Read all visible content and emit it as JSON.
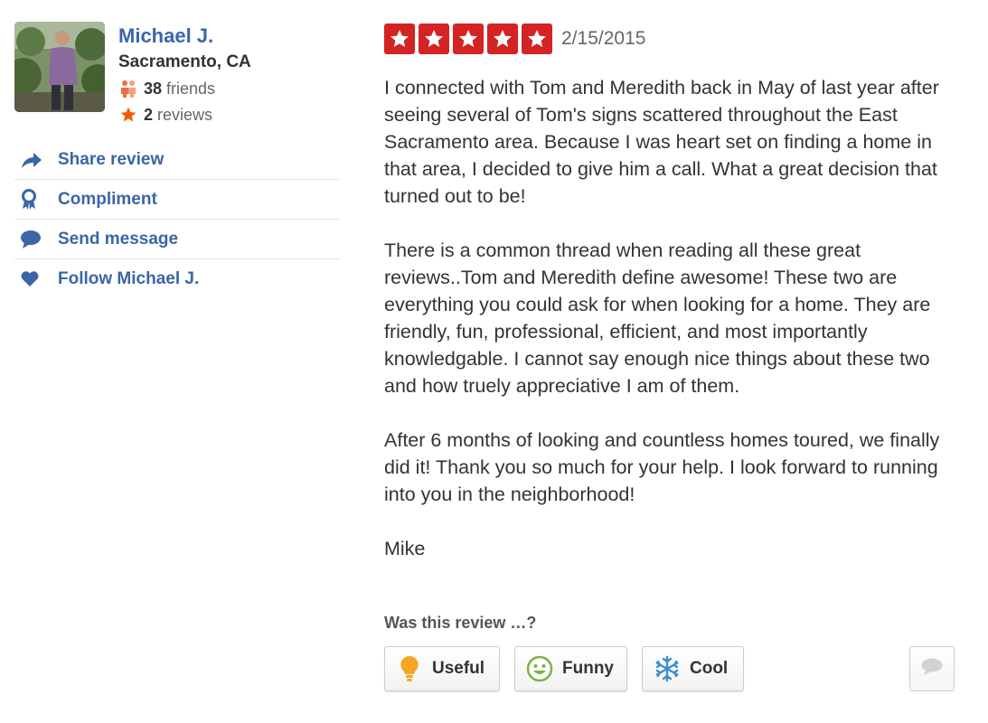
{
  "user": {
    "name": "Michael J.",
    "location": "Sacramento, CA",
    "friends_count": "38",
    "friends_label": "friends",
    "reviews_count": "2",
    "reviews_label": "reviews",
    "avatar_icon": "user-photo"
  },
  "actions": [
    {
      "label": "Share review",
      "icon": "share-arrow-icon"
    },
    {
      "label": "Compliment",
      "icon": "ribbon-icon"
    },
    {
      "label": "Send message",
      "icon": "speech-bubble-icon"
    },
    {
      "label": "Follow Michael J.",
      "icon": "heart-icon"
    }
  ],
  "review": {
    "rating": 5,
    "rating_max": 5,
    "date": "2/15/2015",
    "paragraphs": [
      "I connected with Tom and Meredith back in May of last year after seeing several of Tom's signs scattered throughout the East Sacramento area.  Because I was heart set on finding a home in that area, I decided to give him a call.  What a great decision that turned out to be!",
      "There is a common thread when reading all these great reviews..Tom and Meredith define awesome!  These two are everything you could ask for when looking for a home.  They are friendly, fun, professional, efficient, and most importantly knowledgable.   I cannot say enough nice things about these two and how truely appreciative I am of them.",
      "After 6 months of looking and countless homes toured, we finally did it!  Thank you so much for your help. I look forward to running into you in the neighborhood!",
      "Mike"
    ]
  },
  "votes": {
    "title": "Was this review …?",
    "useful_label": "Useful",
    "funny_label": "Funny",
    "cool_label": "Cool"
  },
  "colors": {
    "link": "#3b65a7",
    "star": "#d32323",
    "text": "#333333"
  }
}
